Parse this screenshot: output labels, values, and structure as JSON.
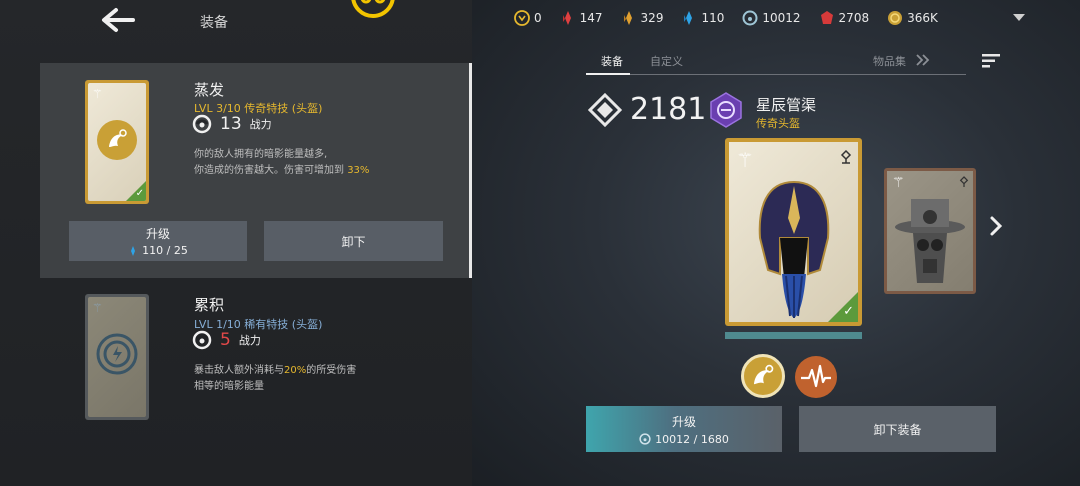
{
  "header": {
    "title": "装备"
  },
  "currencies": [
    {
      "name": "coin-token",
      "value": "0"
    },
    {
      "name": "red-crystal",
      "value": "147"
    },
    {
      "name": "gold-crystal",
      "value": "329"
    },
    {
      "name": "blue-crystal",
      "value": "110"
    },
    {
      "name": "dark-energy",
      "value": "10012"
    },
    {
      "name": "red-gem",
      "value": "2708"
    },
    {
      "name": "gold-coin",
      "value": "366K"
    }
  ],
  "traits": [
    {
      "name": "蒸发",
      "level_label": "LVL",
      "level": "3/10",
      "rarity": "传奇特技 (头盔)",
      "power": "13",
      "power_label": "战力",
      "desc_line1": "你的敌人拥有的暗影能量越多,",
      "desc_line2": "你造成的伤害越大。伤害可增加到",
      "desc_highlight": "33%",
      "upgrade_label": "升级",
      "upgrade_cost": "110 / 25",
      "unequip_label": "卸下"
    },
    {
      "name": "累积",
      "level_label": "LVL",
      "level": "1/10",
      "rarity": "稀有特技 (头盔)",
      "power": "5",
      "power_label": "战力",
      "desc_line1_pre": "暴击敌人额外消耗与",
      "desc_highlight": "20%",
      "desc_line1_post": "的所受伤害",
      "desc_line2": "相等的暗影能量"
    }
  ],
  "tabs": {
    "equip": "装备",
    "custom": "自定义",
    "collection": "物品集"
  },
  "gear": {
    "power": "2181",
    "name": "星辰管渠",
    "rarity": "传奇头盔",
    "upgrade_label": "升级",
    "upgrade_cost": "10012 / 1680",
    "unequip_label": "卸下装备"
  },
  "colors": {
    "gold": "#e6b82e",
    "legendary_frame": "#c99a34",
    "button": "#585e66",
    "highlight_red": "#e24848"
  }
}
